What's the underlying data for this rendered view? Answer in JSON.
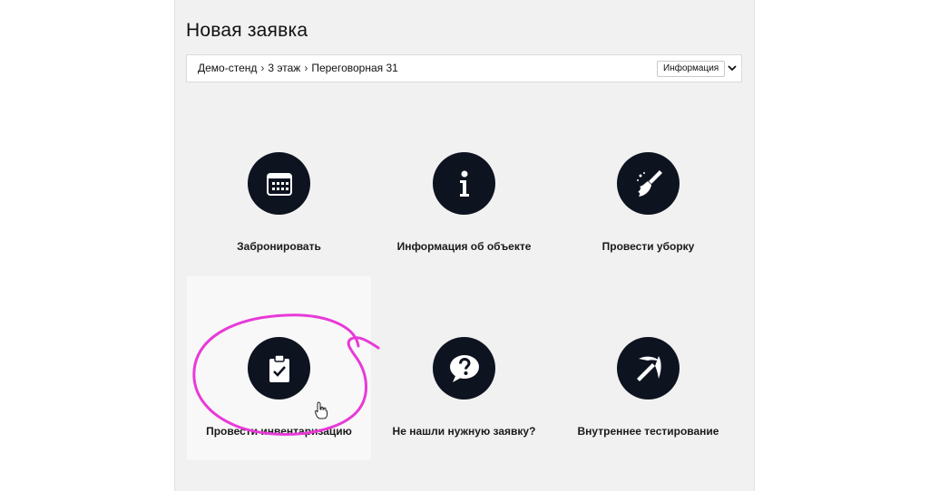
{
  "page": {
    "title": "Новая заявка"
  },
  "location": {
    "breadcrumb": [
      "Демо-стенд",
      "3 этаж",
      "Переговорная 31"
    ],
    "separator": "›",
    "info_button": "Информация",
    "expand_icon": "chevron-down-icon"
  },
  "tiles": [
    {
      "label": "Забронировать",
      "icon": "calendar-icon"
    },
    {
      "label": "Информация об объекте",
      "icon": "info-icon"
    },
    {
      "label": "Провести уборку",
      "icon": "broom-icon"
    },
    {
      "label": "Провести инвентаризацию",
      "icon": "clipboard-check-icon",
      "highlighted": true
    },
    {
      "label": "Не нашли нужную заявку?",
      "icon": "question-bubble-icon"
    },
    {
      "label": "Внутреннее тестирование",
      "icon": "pickaxe-icon"
    }
  ],
  "colors": {
    "icon_circle": "#0e1320",
    "panel_background": "#f0f1f0",
    "annotation": "#e83ad8"
  }
}
